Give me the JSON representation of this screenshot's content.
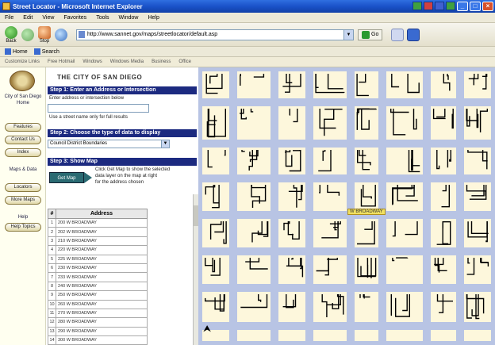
{
  "window": {
    "title": "Street Locator - Microsoft Internet Explorer"
  },
  "menu": [
    "File",
    "Edit",
    "View",
    "Favorites",
    "Tools",
    "Window",
    "Help"
  ],
  "toolbar": {
    "back_label": "Back",
    "forward_label": "",
    "stop_label": "Stop",
    "address_value": "http://www.sannet.gov/maps/streetlocator/default.asp",
    "go_label": "Go",
    "links_label": "Links"
  },
  "linksbar": {
    "items": [
      "Home",
      "Search"
    ]
  },
  "linksbar2": {
    "items": [
      "Customize Links",
      "Free Hotmail",
      "Windows",
      "Windows Media",
      "Business",
      "Office"
    ]
  },
  "leftnav": {
    "seal_caption": "City of San Diego",
    "seal_sub": "Home",
    "buttons": [
      "Features",
      "Contact Us",
      "Index"
    ],
    "caption_mid": "Maps & Data",
    "buttons2": [
      "Locators",
      "More Maps"
    ],
    "caption_low": "Help",
    "buttons3": [
      "Help Topics"
    ]
  },
  "panel": {
    "title": "THE CITY OF SAN DIEGO",
    "step1_header": "Step 1: Enter an Address or Intersection",
    "step1_text": "Enter address or intersection below",
    "step1_input": "",
    "step1_hint": "Use a street name only for full results",
    "step2_header": "Step 2: Choose the type of data to display",
    "step2_select": "Council District Boundaries",
    "step3_header": "Step 3: Show Map",
    "getmap_label": "Get Map",
    "step3_text_1": "Click Get Map to show the selected",
    "step3_text_2": "data layer on the map at right",
    "step3_text_3": "for the address chosen"
  },
  "table": {
    "headers": [
      "#",
      "Address"
    ],
    "rows": [
      [
        "1",
        "200 W BROADWAY"
      ],
      [
        "2",
        "202 W BROADWAY"
      ],
      [
        "3",
        "210 W BROADWAY"
      ],
      [
        "4",
        "220 W BROADWAY"
      ],
      [
        "5",
        "225 W BROADWAY"
      ],
      [
        "6",
        "230 W BROADWAY"
      ],
      [
        "7",
        "233 W BROADWAY"
      ],
      [
        "8",
        "240 W BROADWAY"
      ],
      [
        "9",
        "250 W BROADWAY"
      ],
      [
        "10",
        "260 W BROADWAY"
      ],
      [
        "11",
        "270 W BROADWAY"
      ],
      [
        "12",
        "280 W BROADWAY"
      ],
      [
        "13",
        "290 W BROADWAY"
      ],
      [
        "14",
        "300 W BROADWAY"
      ]
    ]
  },
  "map": {
    "street_label": "W BROADWAY",
    "colors": {
      "street": "#b8c4e4",
      "block": "#fdf7dc",
      "line": "#000000"
    }
  }
}
